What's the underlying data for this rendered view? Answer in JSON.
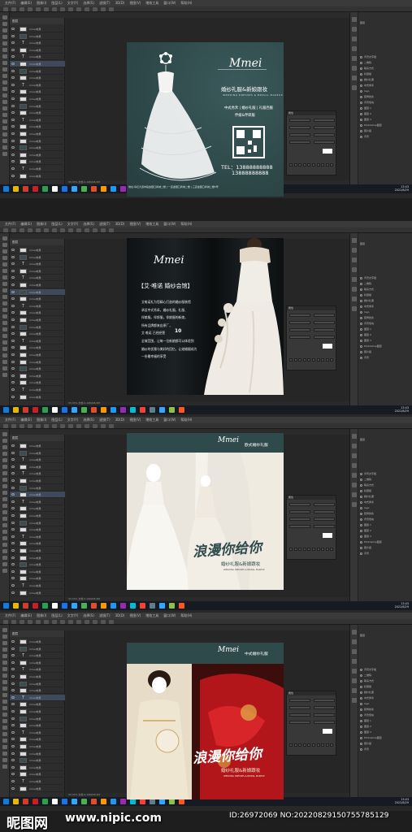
{
  "menu": {
    "items": [
      "文件(F)",
      "编辑(E)",
      "图像(I)",
      "图层(L)",
      "文字(Y)",
      "选择(S)",
      "滤镜(T)",
      "3D(D)",
      "视图(V)",
      "增效工具",
      "窗口(W)",
      "帮助(H)"
    ]
  },
  "tabs": [
    "1.psd @ 33.3%",
    "2.psd @ 33.3%",
    "3.psd @ 33.3% (RGB/8)",
    "4.psd @ 33.3%",
    "5.psd @ 33.3%"
  ],
  "layers_panel": {
    "title": "图层",
    "layer_label": "mmei效果"
  },
  "properties_panel": {
    "title": "属性"
  },
  "right_panel": {
    "title": "图层",
    "rows": [
      "背景文字组",
      "二维码",
      "联系方式",
      "标题组",
      "婚纱礼服",
      "中式秀禾",
      "logo",
      "装饰线条",
      "背景色块",
      "图层 1",
      "图层 2",
      "图层 3",
      "Photoshop图层",
      "照片组",
      "背景"
    ]
  },
  "status_bar": "33.33%  文档:4.19M/48.3M",
  "taskbar": {
    "time": "13:43",
    "date": "2022/8/29"
  },
  "design1": {
    "logo": "Mmei",
    "title": "婚纱礼服&新娘跟妆",
    "subtitle": "WEDDING DRESSES & BRIDAL MAKEUP",
    "desc1": "中式秀禾 | 婚纱礼服 | 礼服西服",
    "desc2": "伴娘&伴郎服",
    "tel_label": "TEL：13888888888",
    "tel2": "13888888888",
    "address": "地址:阜红大道中段金银口商城二楼 | 一店金银口商城二楼 | 三店金银口商城二楼5号"
  },
  "design2": {
    "logo": "Mmei",
    "title": "【艾·唯诺 婚纱会馆】",
    "text_lines": [
      "艾唯诺礼为您精心打造的婚纱服装馆",
      "承设中式秀禾，婚纱礼服，礼服、",
      "伴娘服。伴郎服，伴娘服的新娘，",
      "所有品牌都来自原厂，",
      "艾·唯诺 已经经营",
      "全城范围，让每一位新娘都可以体验到",
      "婚纱的优雅与美好的回忆，让她婚姻成为",
      "一份最幸福的享受"
    ],
    "highlight": "10"
  },
  "design3": {
    "logo": "Mmei",
    "category": "欧式婚纱礼服",
    "script": "浪漫你给你",
    "tagline": "婚纱礼服&新娘跟妆",
    "tagline_en": "WEDDING DRESSES & BRIDAL MAKEUP"
  },
  "design4": {
    "logo": "Mmei",
    "category": "中式婚纱礼服",
    "script": "浪漫你给你",
    "tagline": "婚纱礼服&新娘跟妆",
    "tagline_en": "WEDDING DRESSES & BRIDAL MAKEUP"
  },
  "watermark": {
    "logo": "昵图网",
    "url": "www.nipic.com",
    "id": "ID:26972069 NO:20220829150755785129"
  },
  "colors": {
    "brand_teal": "#2f4a4b",
    "ps_bg": "#282828",
    "taskbar": "#161a22",
    "chinese_red": "#b3161a"
  }
}
